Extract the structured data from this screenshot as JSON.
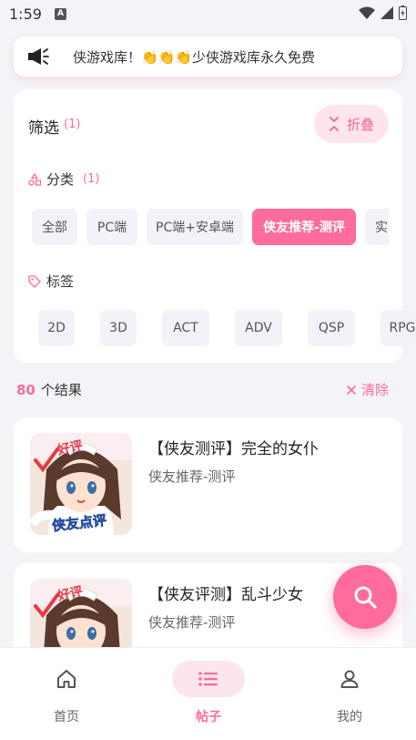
{
  "status": {
    "time": "1:59",
    "notif_letter": "A"
  },
  "notice": {
    "text": "侠游戏库！👏👏👏少侠游戏库永久免费",
    "icon": "megaphone-icon"
  },
  "filter": {
    "title": "筛选",
    "count": "(1)",
    "fold_label": "折叠",
    "category": {
      "label": "分类",
      "count": "(1)",
      "chips": [
        "全部",
        "PC端",
        "PC端+安卓端",
        "侠友推荐-测评",
        "实"
      ],
      "active": "侠友推荐-测评"
    },
    "tags": {
      "label": "标签",
      "chips": [
        "2D",
        "3D",
        "ACT",
        "ADV",
        "QSP",
        "RPG"
      ]
    }
  },
  "results": {
    "count": "80",
    "label": "个结果",
    "clear_label": "清除"
  },
  "posts": [
    {
      "title": "【侠友测评】完全的女仆",
      "category": "侠友推荐-测评",
      "thumb_badge": "好评",
      "thumb_caption": "侠友点评"
    },
    {
      "title": "【侠友评测】乱斗少女",
      "category": "侠友推荐-测评",
      "thumb_badge": "好评",
      "thumb_caption": ""
    }
  ],
  "nav": {
    "items": [
      {
        "label": "首页",
        "icon": "home-icon"
      },
      {
        "label": "帖子",
        "icon": "list-icon"
      },
      {
        "label": "我的",
        "icon": "user-icon"
      }
    ],
    "active": "帖子"
  },
  "colors": {
    "accent": "#ff6b9a",
    "accent_light": "#fde5ee",
    "background": "#f3f4f8"
  }
}
